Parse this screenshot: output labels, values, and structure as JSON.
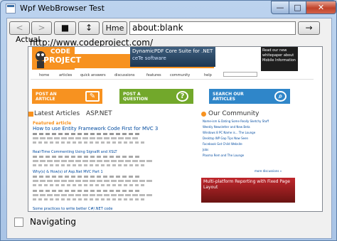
{
  "window": {
    "title": "Wpf WebBrowser Test",
    "min_glyph": "—",
    "max_glyph": "□",
    "close_glyph": "✕"
  },
  "toolbar": {
    "back_glyph": "<",
    "forward_glyph": ">",
    "stop_glyph": "■",
    "refresh_glyph": "↕",
    "home_label": "Hme",
    "address_value": "about:blank",
    "go_glyph": "→"
  },
  "labels": {
    "actual": "Actual",
    "url": "http://www.codeproject.com/"
  },
  "status": {
    "navigating_label": "Navigating",
    "navigating_checked": false
  },
  "colors": {
    "cp_orange": "#f79220",
    "cp_green": "#72a82b",
    "cp_blue": "#2f86c9",
    "cp_link": "#004a9f"
  },
  "page": {
    "logo": {
      "line1": "CODE",
      "line2": "PROJECT"
    },
    "ad": {
      "line1": "DynamicPDF Core Suite for .NET",
      "line2": "ceTe software"
    },
    "ad2": "Read our new whitepaper about Mobile Information",
    "nav": [
      "home",
      "articles",
      "quick answers",
      "discussions",
      "features",
      "community",
      "help"
    ],
    "tiles": {
      "article": {
        "line1": "POST AN",
        "line2": "ARTICLE"
      },
      "question": {
        "line1": "POST A",
        "line2": "QUESTION",
        "icon": "?"
      },
      "search": {
        "line1": "SEARCH OUR",
        "line2": "ARTICLES"
      }
    },
    "latest_title": "Latest Articles",
    "aspnet_title": "ASP.NET",
    "community_title": "Our Community",
    "featured_label": "Featured article",
    "featured_link": "How to use Entity Framework Code First for MVC 3",
    "articles": [
      "Real-Time Commenting Using SignalR and XSLT",
      "Why(s) & How(s) of Asp.Net MVC Part 1"
    ],
    "community": [
      "Name-ism & Dating Some Really Sketchy Stuff",
      "Weekly Newsletter and New Beta",
      "Windows 8 PC Name is... The Lounge",
      "Desktop WP Gap Tips Now Seen",
      "Facebook Got Child Website",
      "Jobs",
      "Plasma Rem and The Lounge"
    ],
    "more_community": "more discussions »",
    "sidebar_ad": "Multi-platform Reporting with Fixed Page Layout",
    "bottom_link": "Some practices to write better C#/.NET code"
  }
}
